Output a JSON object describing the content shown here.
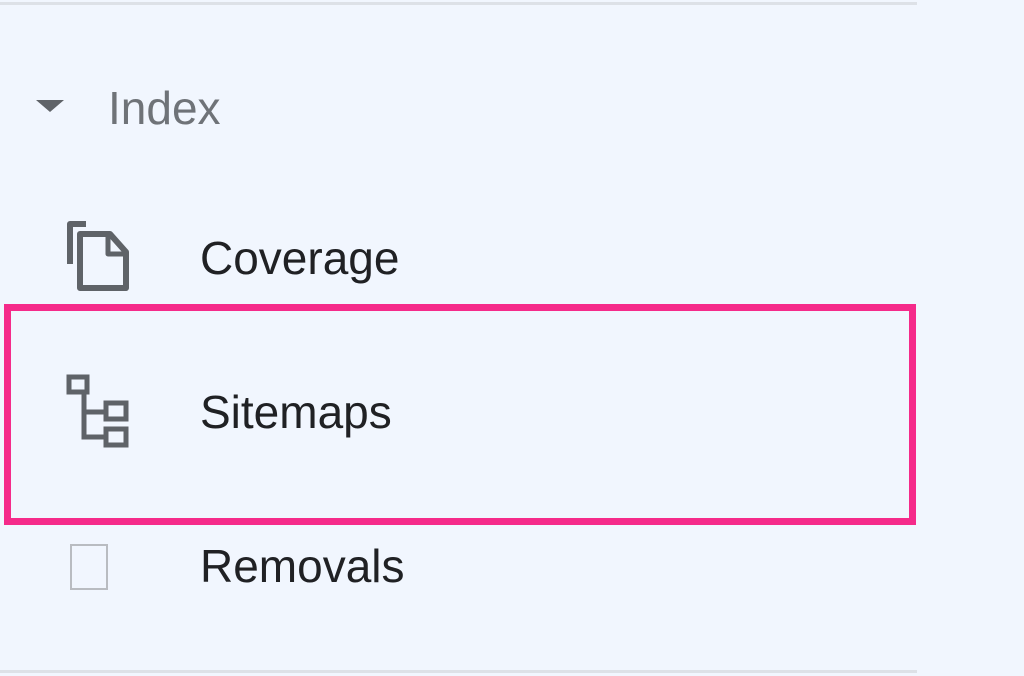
{
  "sidebar": {
    "section": {
      "title": "Index",
      "caret_icon": "caret-down-icon",
      "expanded": true
    },
    "items": [
      {
        "label": "Coverage",
        "icon": "coverage-icon"
      },
      {
        "label": "Sitemaps",
        "icon": "sitemap-icon",
        "highlighted": true
      },
      {
        "label": "Removals",
        "icon": "removals-icon"
      }
    ]
  },
  "colors": {
    "background": "#f1f6fe",
    "divider": "#dde1e7",
    "section_title": "#6f7378",
    "label": "#202124",
    "icon": "#5f6368",
    "highlight": "#f52a8a"
  }
}
